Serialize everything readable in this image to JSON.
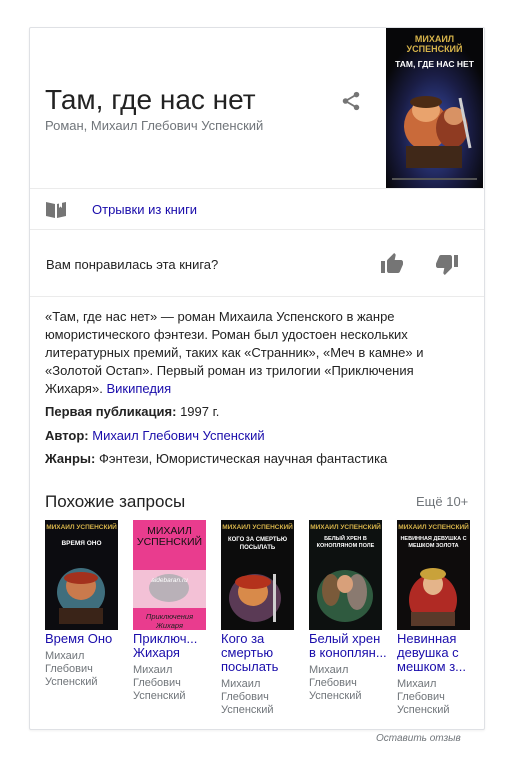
{
  "book": {
    "title": "Там, где нас нет",
    "subtitle": "Роман, Михаил Глебович Успенский",
    "cover": {
      "author": "МИХАИЛ УСПЕНСКИЙ",
      "title": "ТАМ, ГДЕ НАС НЕТ"
    }
  },
  "excerpts": {
    "label": "Отрывки из книги"
  },
  "rating": {
    "question": "Вам понравилась эта книга?"
  },
  "description": {
    "text": "«Там, где нас нет» — роман Михаила Успенского в жанре юмористического фэнтези. Роман был удостоен нескольких литературных премий, таких как «Странник», «Меч в камне» и «Золотой Остап». Первый роман из трилогии «Приключения Жихаря».",
    "source": "Википедия"
  },
  "facts": {
    "published_label": "Первая публикация:",
    "published_value": "1997 г.",
    "author_label": "Автор:",
    "author_value": "Михаил Глебович Успенский",
    "genres_label": "Жанры:",
    "genres_value": "Фэнтези, Юмористическая научная фантастика"
  },
  "similar": {
    "heading": "Похожие запросы",
    "more": "Ещё 10+",
    "items": [
      {
        "title": "Время Оно",
        "author": "Михаил Глебович Успенский",
        "cover_author": "МИХАИЛ УСПЕНСКИЙ",
        "cover_title": "ВРЕМЯ ОНО"
      },
      {
        "title": "Приключ... Жихаря",
        "author": "Михаил Глебович Успенский",
        "cover_author": "МИХАИЛ УСПЕНСКИЙ",
        "cover_title": "Приключения Жихаря",
        "watermark": "aldebaran.ru"
      },
      {
        "title": "Кого за смертью посылать",
        "author": "Михаил Глебович Успенский",
        "cover_author": "МИХАИЛ УСПЕНСКИЙ",
        "cover_title": "КОГО ЗА СМЕРТЬЮ ПОСЫЛАТЬ"
      },
      {
        "title": "Белый хрен в коноплян...",
        "author": "Михаил Глебович Успенский",
        "cover_author": "МИХАИЛ УСПЕНСКИЙ",
        "cover_title": "БЕЛЫЙ ХРЕН В КОНОПЛЯНОМ ПОЛЕ"
      },
      {
        "title": "Невинная девушка с мешком з...",
        "author": "Михаил Глебович Успенский",
        "cover_author": "МИХАИЛ УСПЕНСКИЙ",
        "cover_title": "НЕВИННАЯ ДЕВУШКА С МЕШКОМ ЗОЛОТА"
      }
    ]
  },
  "feedback": {
    "label": "Оставить отзыв"
  },
  "colors": {
    "link": "#1a0dab",
    "muted": "#70757a",
    "text": "#222222",
    "icon": "#757575"
  }
}
